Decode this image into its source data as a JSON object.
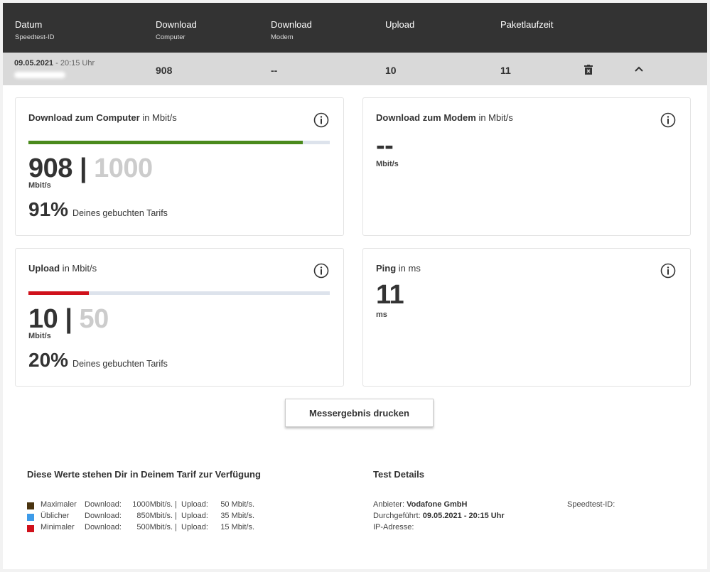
{
  "header": {
    "columns": [
      {
        "label": "Datum",
        "sub": "Speedtest-ID"
      },
      {
        "label": "Download",
        "sub": "Computer"
      },
      {
        "label": "Download",
        "sub": "Modem"
      },
      {
        "label": "Upload",
        "sub": ""
      },
      {
        "label": "Paketlaufzeit",
        "sub": ""
      }
    ]
  },
  "row": {
    "date": "09.05.2021",
    "time": " - 20:15 Uhr",
    "download_computer": "908",
    "download_modem": "--",
    "upload": "10",
    "ping": "11"
  },
  "cards": {
    "download_computer": {
      "title_bold": "Download zum Computer",
      "title_rest": " in Mbit/s",
      "value": "908",
      "separator": " | ",
      "max": "1000",
      "unit": "Mbit/s",
      "percent": "91%",
      "percent_label": "Deines gebuchten Tarifs",
      "fill_fraction": 0.91,
      "fill_color": "#4a8a1c"
    },
    "download_modem": {
      "title_bold": "Download zum Modem",
      "title_rest": " in Mbit/s",
      "value": "--",
      "unit": "Mbit/s"
    },
    "upload": {
      "title_bold": "Upload",
      "title_rest": " in Mbit/s",
      "value": "10",
      "separator": " | ",
      "max": "50",
      "unit": "Mbit/s",
      "percent": "20%",
      "percent_label": "Deines gebuchten Tarifs",
      "fill_fraction": 0.2,
      "fill_color": "#d0111b"
    },
    "ping": {
      "title_bold": "Ping",
      "title_rest": " in ms",
      "value": "11",
      "unit": "ms"
    }
  },
  "print_button": "Messergebnis drucken",
  "tarif": {
    "title": "Diese Werte stehen Dir in Deinem Tarif zur Verfügung",
    "rows": [
      {
        "name": "Maximaler",
        "dl_label": "Download:",
        "dl": "1000Mbit/s. |",
        "ul_label": "Upload:",
        "ul": "50 Mbit/s.",
        "color": "#4a3410"
      },
      {
        "name": "Üblicher",
        "dl_label": "Download:",
        "dl": "850Mbit/s. |",
        "ul_label": "Upload:",
        "ul": "35 Mbit/s.",
        "color": "#3d9be9"
      },
      {
        "name": "Minimaler",
        "dl_label": "Download:",
        "dl": "500Mbit/s. |",
        "ul_label": "Upload:",
        "ul": "15 Mbit/s.",
        "color": "#d0111b"
      }
    ]
  },
  "details": {
    "title": "Test Details",
    "provider_label": "Anbieter:",
    "provider": "Vodafone GmbH",
    "performed_label": "Durchgeführt:",
    "performed": "09.05.2021 - 20:15 Uhr",
    "ip_label": "IP-Adresse:",
    "speedtest_id_label": "Speedtest-ID:"
  },
  "icons": {
    "info": "info-circle-icon",
    "delete": "trash-icon",
    "collapse": "chevron-up-icon"
  }
}
